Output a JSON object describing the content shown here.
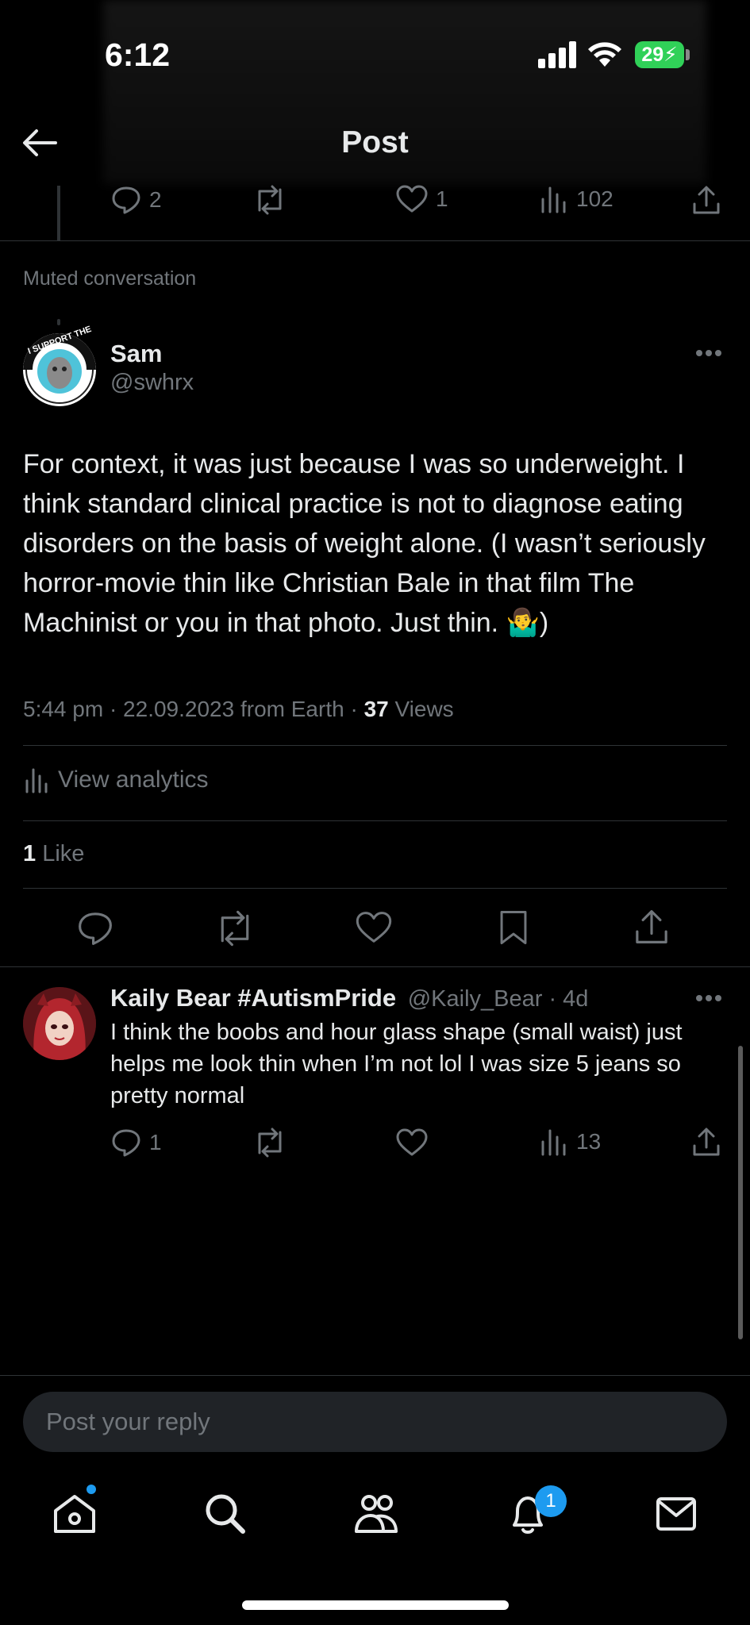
{
  "status_bar": {
    "time": "6:12",
    "battery": "29"
  },
  "header": {
    "title": "Post"
  },
  "prev_post_actions": {
    "replies": "2",
    "likes": "1",
    "views": "102"
  },
  "muted_label": "Muted conversation",
  "main_post": {
    "author": "Sam",
    "handle": "@swhrx",
    "avatar_text": "I SUPPORT THE",
    "text": "For context, it was just because I was so underweight. I think standard clinical practice is not to diagnose eating disorders on the basis of weight alone. (I wasn’t seriously horror-movie thin like Christian Bale in that film The Machinist or you in that photo. Just thin. 🤷‍♂️)",
    "timestamp": "5:44 pm · 22.09.2023 from Earth · ",
    "views_count": "37",
    "views_label": " Views",
    "analytics_label": "View analytics",
    "likes_count": "1",
    "likes_label": " Like"
  },
  "reply": {
    "author": "Kaily Bear #AutismPride",
    "handle": "@Kaily_Bear · 4d",
    "text": "I think the boobs and hour glass shape (small waist) just helps me look thin when I’m not lol I was size 5 jeans so pretty normal",
    "replies": "1",
    "views": "13"
  },
  "composer": {
    "placeholder": "Post your reply"
  },
  "tabbar": {
    "notifications_badge": "1"
  },
  "colors": {
    "accent": "#1d9bf0",
    "battery": "#30d158",
    "background": "#000000"
  }
}
